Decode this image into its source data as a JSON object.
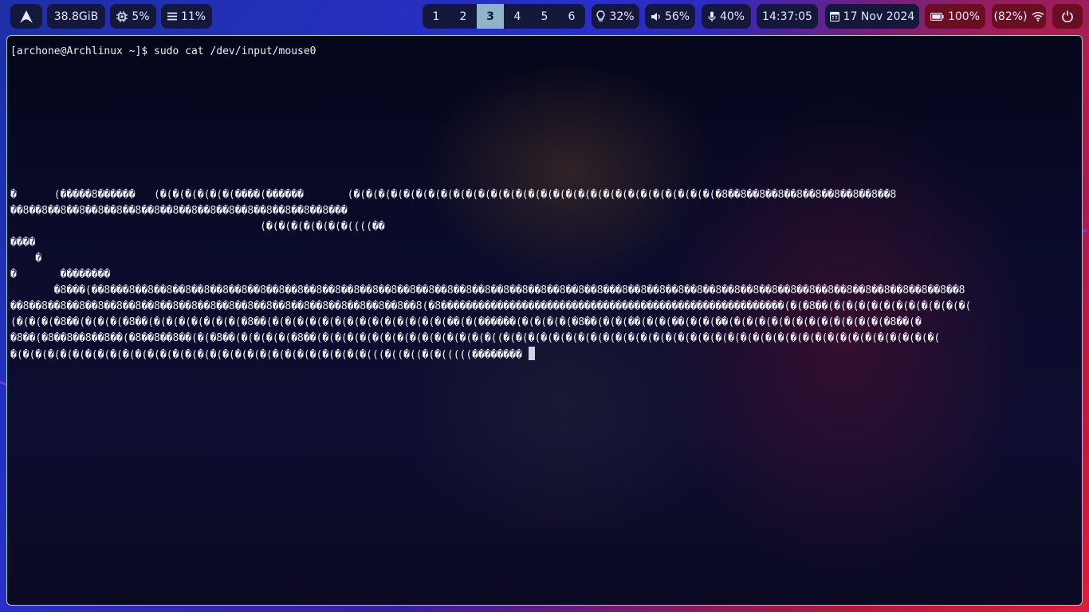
{
  "topbar": {
    "launcher_icon": "arch-linux-logo",
    "memory": "38.8GiB",
    "cpu": {
      "icon": "cpu-chip-icon",
      "value": "5%"
    },
    "load": {
      "icon": "menu-lines-icon",
      "value": "11%"
    },
    "workspaces": [
      "1",
      "2",
      "3",
      "4",
      "5",
      "6"
    ],
    "active_workspace": "3",
    "brightness": {
      "icon": "lightbulb-icon",
      "value": "32%"
    },
    "volume": {
      "icon": "speaker-icon",
      "value": "56%"
    },
    "microphone": {
      "icon": "microphone-icon",
      "value": "40%"
    },
    "clock": "14:37:05",
    "date": {
      "icon": "calendar-icon",
      "value": "17 Nov 2024"
    },
    "battery": {
      "icon": "battery-icon",
      "value": "100%"
    },
    "wifi": {
      "icon": "wifi-icon",
      "value": "(82%)"
    },
    "power_icon": "power-icon",
    "colors": {
      "pill": "#14183a",
      "active_workspace": "#8fb3c9",
      "alert_pill": "#6a0f22"
    }
  },
  "terminal": {
    "prompt": "[archone@Archlinux ~]$ sudo cat /dev/input/mouse0",
    "output_lines": [
      "",
      "",
      "",
      "",
      "",
      "",
      "",
      "",
      "�      (�����8������   (�(�(�(�(�(�(����(������       (�(�(�(�(�(�(�(�(�(�(�(�(�(�(�(�(�(�(�(�(�(�(�(�(�(�(�(�(�(�8��8��8��8��8��8��8��8��8��8",
      "��8��8��8��8��8��8��8��8��8��8��8��8��8��8��8��8��8���",
      "                                        (�(�(�(�(�(�(�((((��",
      "����",
      "    �",
      "�       ��������",
      "       �8���(��8���8��8��8��8��8��8��8��8��8��8��8��8��8��8��8��8��8��8��8��8��8��8��8��8��8��8���8��8��8��8��8��8��8��8��8��8��8��8��8��8��8��8��8��8��8",
      "��8��8��8��8��8��8��8��8��8��8��8��8��8��8��8��8��8��8��8��8��8��8(�8�������������������������������������������������������(�(�8��(�(�(�(�(�(�(�(�(�(�(�(",
      "(�(�(�(�8��(�(�(�(�8��(�(�(�(�(�(�(�(�8��(�(�(�(�(�(�(�(�(�(�(�(�(�(�(��(�(������(�(�(�(�(�8��(�(�(��(�(�(��(�(�(��(�(�(�(�(�(�(�(�(�(�(�(�(�8��(�",
      "�8��(�8��8��8��8��(�8��8��8��(�(�8��(�(�(�(�(�8��(�(�(�(�(�(�(�(�(�(�(�(�(�(�((�(�(�(�(�(�(�(�(�(�(�(�(�(�(�(�(�(�(�(�(�(�(�(�(�(�(�(�(�(�(�(�(�(�(�(",
      "�(�(�(�(�(�(�(�(�(�(�(�(�(�(�(�(�(�(�(�(�(�(�(�(�(�(�(�(�(((�((�((�(�(((((��������"
    ]
  }
}
